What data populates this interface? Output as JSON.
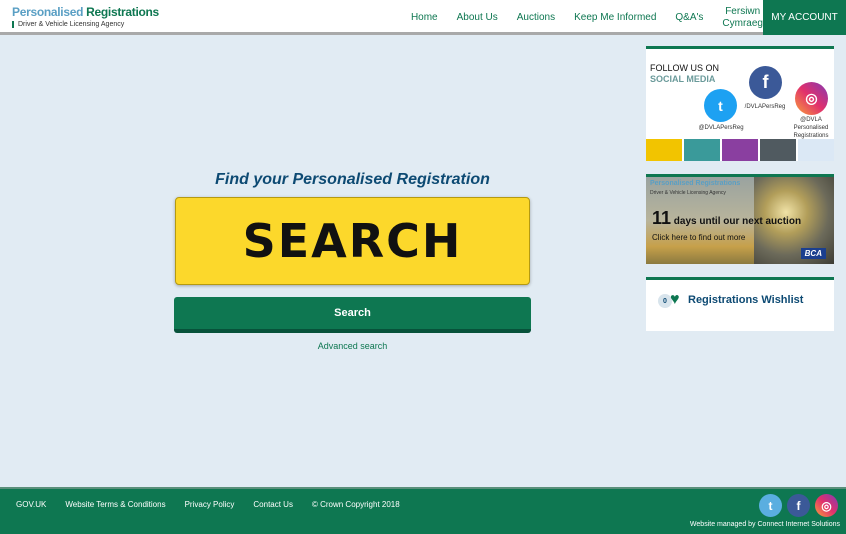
{
  "header": {
    "logo_title_a": "Personalised",
    "logo_title_b": " Registrations",
    "logo_subtitle": "Driver & Vehicle Licensing Agency",
    "nav": [
      "Home",
      "About Us",
      "Auctions",
      "Keep Me Informed",
      "Q&A's"
    ],
    "welsh_a": "Fersiwn",
    "welsh_b": "Cymraeg",
    "account": "MY ACCOUNT"
  },
  "main": {
    "heading": "Find your Personalised Registration",
    "plate_value": "SEARCH",
    "search_button": "Search",
    "advanced_link": "Advanced search"
  },
  "sidebar": {
    "social": {
      "line1": "FOLLOW US ON",
      "line2": "SOCIAL MEDIA",
      "twitter": "@DVLAPersReg",
      "facebook": "/DVLAPersReg",
      "instagram_a": "@DVLA",
      "instagram_b": "Personalised",
      "instagram_c": "Registrations"
    },
    "auction": {
      "logo_title": "Personalised Registrations",
      "logo_subtitle": "Driver & Vehicle Licensing Agency",
      "days": "11",
      "days_text": " days until our next auction",
      "cta": "Click here to find out more",
      "brand": "BCA"
    },
    "wishlist": {
      "count": "0",
      "label": "Registrations Wishlist"
    }
  },
  "footer": {
    "links": [
      "GOV.UK",
      "Website Terms & Conditions",
      "Privacy Policy",
      "Contact Us",
      "© Crown Copyright 2018"
    ],
    "managed": "Website managed by Connect Internet Solutions"
  },
  "colors": {
    "brand_green": "#0e7751",
    "plate_yellow": "#fcd82b",
    "heading_blue": "#0d4a73",
    "twitter": "#1da1f2",
    "facebook": "#3b5998"
  }
}
